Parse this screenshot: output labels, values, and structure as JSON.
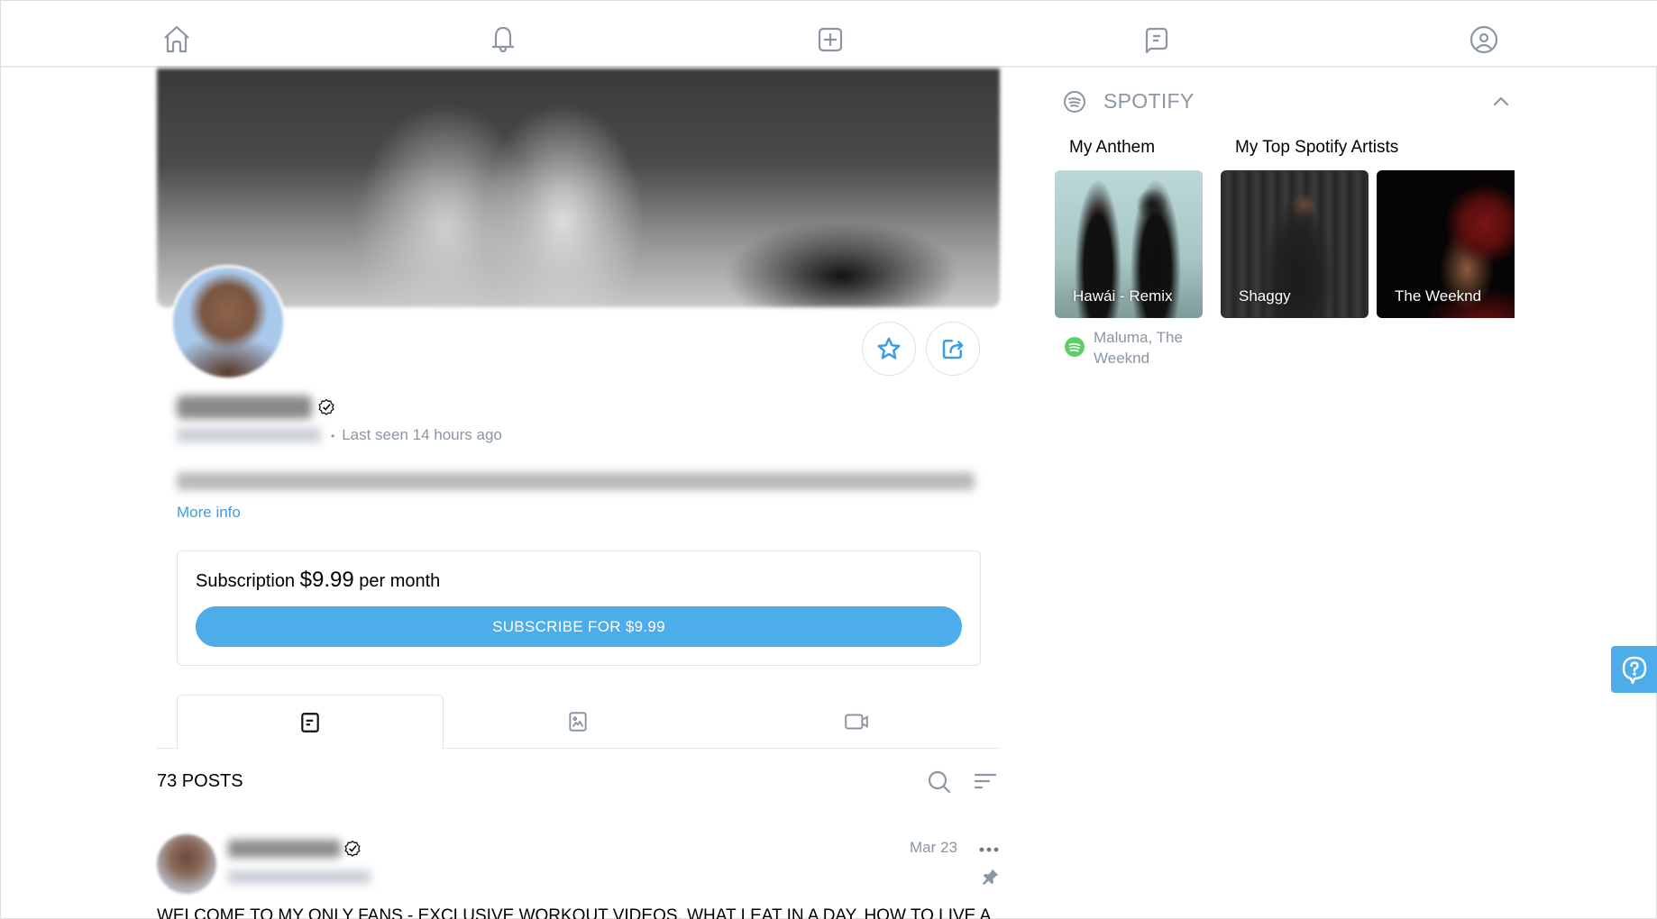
{
  "nav": {
    "items": [
      {
        "name": "home",
        "icon": "home-icon"
      },
      {
        "name": "notifications",
        "icon": "bell-icon"
      },
      {
        "name": "new-post",
        "icon": "plus-square-icon"
      },
      {
        "name": "messages",
        "icon": "chat-icon"
      },
      {
        "name": "profile",
        "icon": "user-circle-icon"
      }
    ]
  },
  "profile": {
    "name": "Jono Castano",
    "verified": true,
    "handle": "@jonocastanoacero",
    "separator": "•",
    "last_seen": "Last seen 14 hours ago",
    "bio": "Growing up in Colombia, football was a huge part of my life and my goal was always to be the be...",
    "more_info": "More info"
  },
  "subscription": {
    "label": "Subscription",
    "price": "$9.99",
    "period": "per month",
    "button": "SUBSCRIBE FOR $9.99"
  },
  "tabs": [
    {
      "name": "posts",
      "icon": "text-post-icon",
      "active": true
    },
    {
      "name": "photos",
      "icon": "image-icon",
      "active": false
    },
    {
      "name": "videos",
      "icon": "video-icon",
      "active": false
    }
  ],
  "posts": {
    "count_label": "73 POSTS",
    "items": [
      {
        "author": "Jono Castano",
        "handle": "@jonocastanoacero",
        "date": "Mar 23",
        "pinned": true,
        "text": "WELCOME TO MY ONLY FANS - EXCLUSIVE WORKOUT VIDEOS, WHAT I EAT IN A DAY, HOW TO LIVE A"
      }
    ]
  },
  "spotify": {
    "title": "SPOTIFY",
    "anthem_heading": "My Anthem",
    "artists_heading": "My Top Spotify Artists",
    "anthem": {
      "title": "Hawái - Remix",
      "artists": "Maluma, The Weeknd"
    },
    "top_artists": [
      {
        "name": "Shaggy"
      },
      {
        "name": "The Weeknd"
      }
    ]
  },
  "colors": {
    "accent": "#4dacea",
    "link": "#3a9ee6",
    "muted_text": "#8a96a3",
    "spotify_green": "#1ed760"
  }
}
